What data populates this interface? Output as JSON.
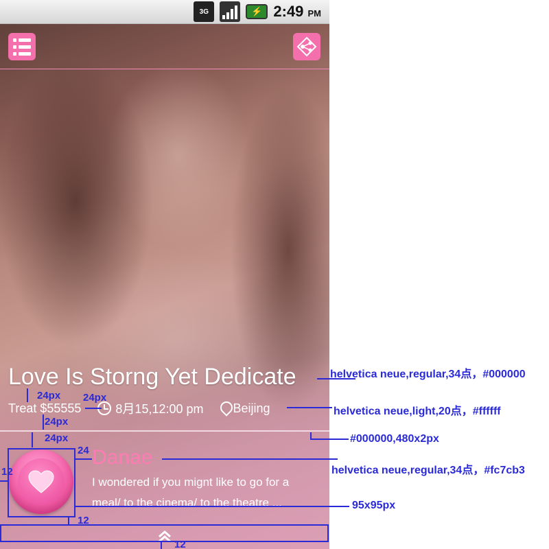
{
  "statusbar": {
    "network_label": "3G",
    "time": "2:49",
    "ampm": "PM"
  },
  "post": {
    "title": "Love Is Storng Yet Dedicate",
    "treat": "Treat $55555",
    "datetime": "8月15,12:00 pm",
    "location": "Beijing"
  },
  "message": {
    "name": "Danae",
    "text": "I wondered if you mignt like to go for a meal/ to the  cinema/ to the theatre ..."
  },
  "annotations": {
    "title_spec": "helvetica neue,regular,34点，#000000",
    "meta_spec": "helvetica neue,light,20点，#ffffff",
    "divider_spec": "#000000,480x2px",
    "name_spec": "helvetica neue,regular,34点，#fc7cb3",
    "avatar_spec": "95x95px",
    "gap_24a": "24px",
    "gap_24b": "24px",
    "gap_24c": "24px",
    "gap_24d": "24px",
    "gap_24e": "24",
    "gap_12a": "12",
    "gap_12b": "12",
    "gap_12c": "12"
  },
  "colors": {
    "accent_pink": "#f370ac",
    "name_pink": "#fc7cb3",
    "annotation_blue": "#2a2ad6"
  },
  "icons": [
    "menu-icon",
    "share-icon",
    "clock-icon",
    "location-pin-icon",
    "heart-icon",
    "chevron-up-icon",
    "signal-icon",
    "battery-icon"
  ]
}
